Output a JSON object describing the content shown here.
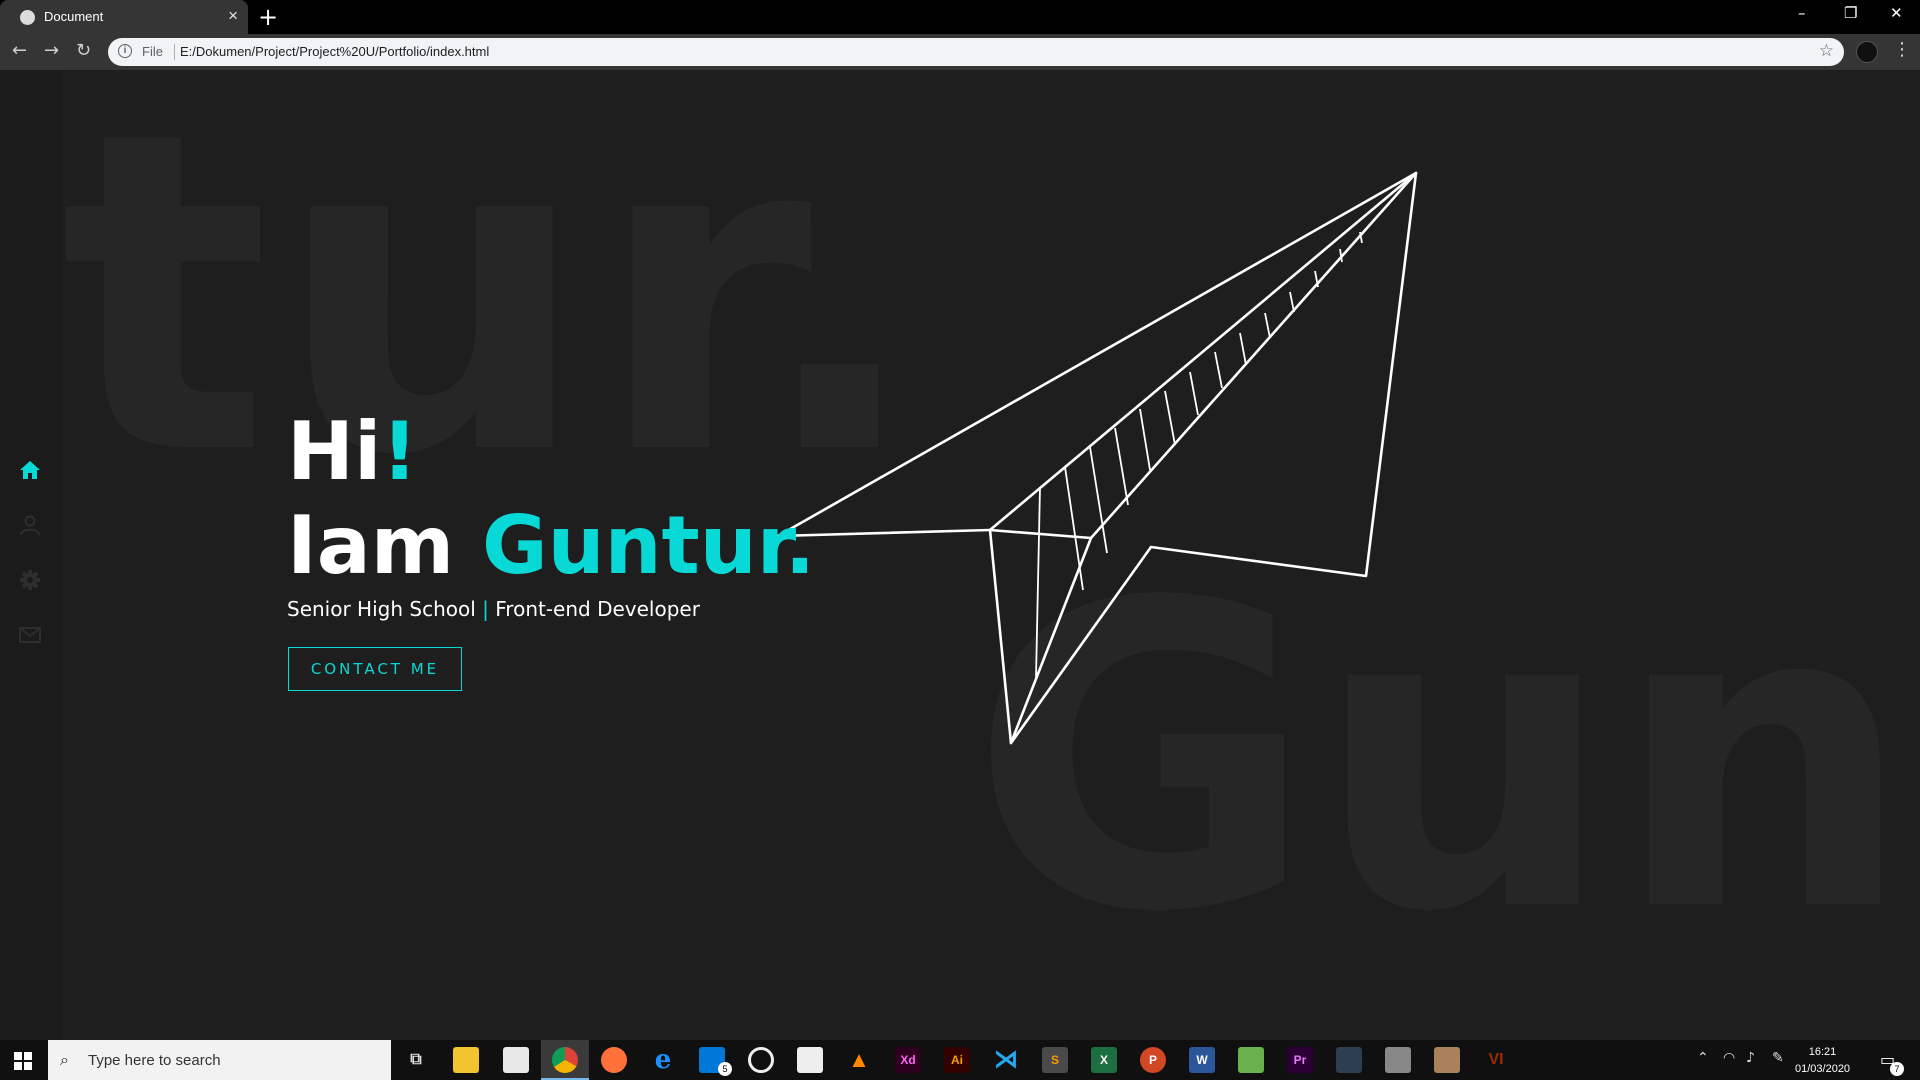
{
  "browser": {
    "tab_title": "Document",
    "tab_close": "×",
    "new_tab": "+",
    "window_controls": {
      "minimize": "–",
      "restore": "❐",
      "close": "✕"
    },
    "nav": {
      "back": "←",
      "forward": "→",
      "reload": "↻"
    },
    "address": {
      "scheme": "File",
      "url": "E:/Dokumen/Project/Project%20U/Portfolio/index.html"
    },
    "bookmark_icon": "star-icon",
    "menu": "⋮"
  },
  "page": {
    "background_words": {
      "top": "tur.",
      "bottom": "Gun"
    },
    "sidebar": {
      "items": [
        {
          "name": "home-icon",
          "active": true
        },
        {
          "name": "user-icon",
          "active": false
        },
        {
          "name": "gear-icon",
          "active": false
        },
        {
          "name": "mail-icon",
          "active": false
        }
      ]
    },
    "hero": {
      "greeting": "Hi",
      "greeting_mark": "!",
      "intro": "Iam",
      "name": "Guntur.",
      "role_school": "Senior High School",
      "role_separator": "|",
      "role_job": "Front-end Developer",
      "cta_label": "CONTACT ME"
    },
    "colors": {
      "accent": "#08d9d6",
      "background": "#1e1e1e",
      "text": "#ffffff"
    }
  },
  "taskbar": {
    "search_placeholder": "Type here to search",
    "pinned": [
      "task-view-icon",
      "file-explorer-icon",
      "store-icon",
      "chrome-icon",
      "firefox-icon",
      "edge-icon",
      "mail-icon",
      "groove-icon",
      "video-editor-icon",
      "vlc-icon",
      "adobe-xd-icon",
      "illustrator-icon",
      "vscode-icon",
      "sublime-icon",
      "excel-icon",
      "powerpoint-icon",
      "word-icon",
      "corel-icon",
      "premiere-icon",
      "app-icon",
      "photo-icon",
      "photo2-icon",
      "vi-icon"
    ],
    "labels": {
      "xd": "Xd",
      "ai": "Ai",
      "pr": "Pr",
      "vi": "VI",
      "excel": "X",
      "word": "W",
      "ppt": "P"
    },
    "mail_badge": "5",
    "clock": {
      "time": "16:21",
      "date": "01/03/2020"
    },
    "notification_badge": "7"
  }
}
